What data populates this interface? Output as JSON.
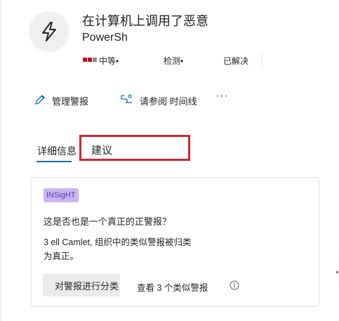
{
  "alert": {
    "title": "在计算机上调用了恶意",
    "subtitle": "PowerSh",
    "severity_label": "中等•",
    "detection_label": "检测•",
    "status_label": "已解决",
    "severity_colors": [
      "#c50f1f",
      "#c50f1f",
      "#8a8886"
    ]
  },
  "actions": {
    "manage_label": "管理警报",
    "timeline_label": "请参阅 时间线",
    "more_label": "···"
  },
  "tabs": {
    "details_label": "详细信息",
    "recommendations_label": "建议"
  },
  "insight": {
    "badge_label": "INSigHT",
    "question": "这是否也是一个真正的正警报？",
    "desc_line1": "3 ell Camlet, 组织中的类似警报被归类",
    "desc_line2": "为真正。",
    "classify_label": "对警报进行分类",
    "view_similar_label": "查看 3 个类似警报"
  },
  "colors": {
    "accent": "#0f6cbd",
    "highlight": "#d8232f",
    "insight_bg": "#c9b5f2"
  }
}
